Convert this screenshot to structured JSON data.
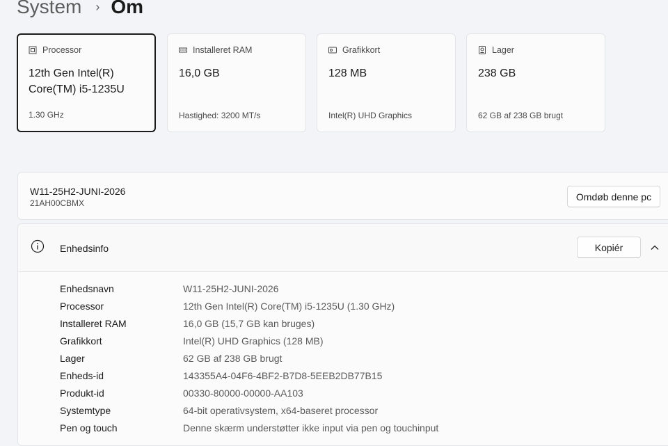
{
  "breadcrumb": {
    "parent": "System",
    "separator": "›",
    "current": "Om"
  },
  "cards": [
    {
      "title": "Processor",
      "value": "12th Gen Intel(R) Core(TM) i5-1235U",
      "sub": "1.30 GHz",
      "icon": "processor-icon"
    },
    {
      "title": "Installeret RAM",
      "value": "16,0 GB",
      "sub": "Hastighed: 3200 MT/s",
      "icon": "ram-icon"
    },
    {
      "title": "Grafikkort",
      "value": "128 MB",
      "sub": "Intel(R) UHD Graphics",
      "icon": "graphics-card-icon"
    },
    {
      "title": "Lager",
      "value": "238 GB",
      "sub": "62 GB af 238 GB brugt",
      "icon": "storage-icon"
    }
  ],
  "pc": {
    "name": "W11-25H2-JUNI-2026",
    "model": "21AH00CBMX",
    "rename_label": "Omdøb denne pc"
  },
  "device_info": {
    "title": "Enhedsinfo",
    "copy_label": "Kopiér",
    "rows": [
      {
        "label": "Enhedsnavn",
        "value": "W11-25H2-JUNI-2026"
      },
      {
        "label": "Processor",
        "value": "12th Gen Intel(R) Core(TM) i5-1235U (1.30 GHz)"
      },
      {
        "label": "Installeret RAM",
        "value": "16,0 GB (15,7 GB kan bruges)"
      },
      {
        "label": "Grafikkort",
        "value": "Intel(R) UHD Graphics (128 MB)"
      },
      {
        "label": "Lager",
        "value": "62 GB af 238 GB brugt"
      },
      {
        "label": "Enheds-id",
        "value": "143355A4-04F6-4BF2-B7D8-5EEB2DB77B15"
      },
      {
        "label": "Produkt-id",
        "value": "00330-80000-00000-AA103"
      },
      {
        "label": "Systemtype",
        "value": "64-bit operativsystem, x64-baseret processor"
      },
      {
        "label": "Pen og touch",
        "value": "Denne skærm understøtter ikke input via pen og touchinput"
      }
    ]
  }
}
